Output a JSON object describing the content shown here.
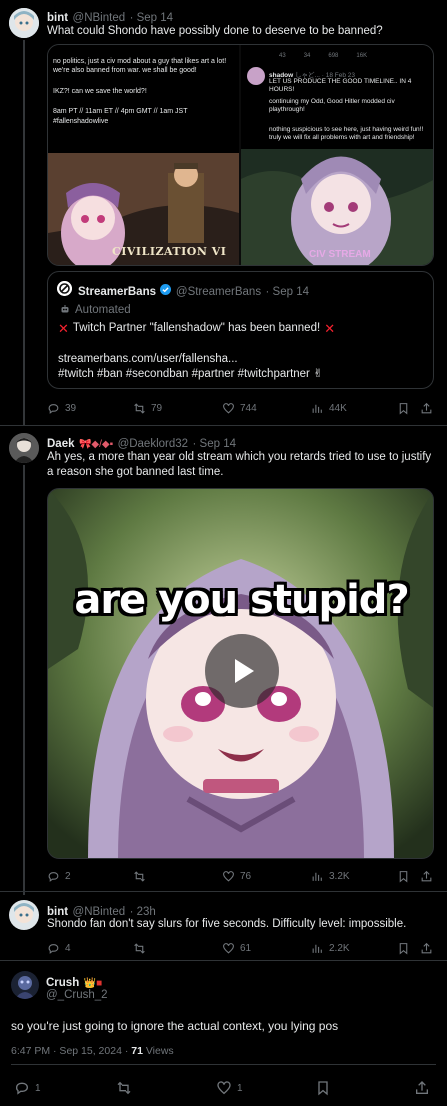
{
  "post1": {
    "name": "bint",
    "handle": "@NBinted",
    "time": "· Sep 14",
    "text": "What could Shondo have possibly done to deserve to be banned?",
    "quote": {
      "left_text_1": "no politics, just a civ mod about a guy that likes art a lot! we're also banned from war. we shall be good!",
      "left_text_2": "IKZ?! can we save the world?!",
      "left_text_3": "8am PT // 11am ET // 4pm GMT // 1am JST",
      "left_hashtag": "#fallenshadowlive",
      "game_title": "CIVILIZATION VI",
      "right_stats": [
        "43",
        "34",
        "698",
        "16K"
      ],
      "right_name": "shadow",
      "right_handle": "しゃど...",
      "right_time": "· 18 Feb 23",
      "right_text_1": "LET US PRODUCE THE GOOD TIMELINE.. IN 4 HOURS!",
      "right_text_2": "continuing my Odd, Good Hitler modded civ playthrough!",
      "right_text_3": "nothing suspicious to see here, just having weird fun!! truly we will fix all problems with art and friendship!",
      "right_banner": "CIV STREAM"
    },
    "embed": {
      "name": "StreamerBans",
      "handle": "@StreamerBans",
      "time": "· Sep 14",
      "automated": "Automated",
      "headline": "Twitch Partner \"fallenshadow\" has been banned!",
      "url": "streamerbans.com/user/fallensha...",
      "tags": "#twitch #ban #secondban #partner #twitchpartner"
    },
    "stats": {
      "replies": "39",
      "reposts": "79",
      "likes": "744",
      "views": "44K"
    }
  },
  "post2": {
    "name": "Daek",
    "handle": "@Daeklord32",
    "time": "· Sep 14",
    "text": "Ah yes, a more than year old stream which you retards tried to use to justify a reason she got banned last time.",
    "video_caption": "are you stupid?",
    "stats": {
      "replies": "2",
      "reposts": "",
      "likes": "76",
      "views": "3.2K"
    }
  },
  "post3": {
    "name": "bint",
    "handle": "@NBinted",
    "time": "· 23h",
    "text": "Shondo fan don't say slurs for five seconds. Difficulty level: impossible.",
    "stats": {
      "replies": "4",
      "reposts": "",
      "likes": "61",
      "views": "2.2K"
    }
  },
  "main": {
    "name": "Crush",
    "handle": "@_Crush_2",
    "text": "so you're just going to ignore the actual context, you lying pos",
    "timestamp": "6:47 PM · Sep 15, 2024 ·",
    "views_count": "71",
    "views_label": "Views",
    "stats": {
      "replies": "1",
      "likes": "1"
    }
  },
  "colors": {
    "background": "#000000",
    "muted": "#71767b",
    "link": "#1d9bf0",
    "divider": "#2f3336",
    "verified": "#1d9bf0",
    "ban": "#f4212e"
  }
}
